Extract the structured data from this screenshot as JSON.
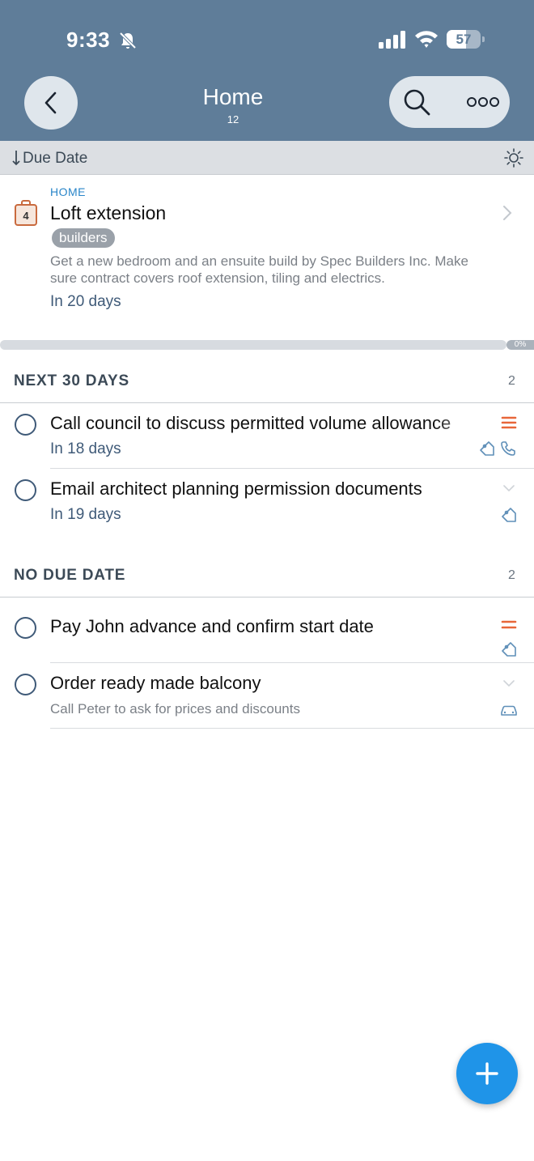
{
  "status_bar": {
    "time": "9:33",
    "battery": "57",
    "battery_level": 0.57
  },
  "header": {
    "title": "Home",
    "count": "12"
  },
  "sort": {
    "label": "Due Date"
  },
  "project": {
    "breadcrumb": "HOME",
    "title": "Loft extension",
    "tag": "builders",
    "notes": "Get a new bedroom and an ensuite build by Spec Builders Inc. Make sure contract covers roof extension, tiling and electrics.",
    "due": "In 20 days",
    "badge_number": "4",
    "progress_label": "0%",
    "progress_value": 0
  },
  "sections": [
    {
      "title": "NEXT 30 DAYS",
      "count": "2",
      "tasks": [
        {
          "title": "Call council to discuss permitted volume allowance",
          "due": "In 18 days",
          "priority": "high",
          "icons": [
            "tag-icon",
            "phone-icon"
          ]
        },
        {
          "title": "Email architect planning permission documents",
          "due": "In 19 days",
          "priority": "none",
          "icons": [
            "tag-icon"
          ]
        }
      ]
    },
    {
      "title": "NO DUE DATE",
      "count": "2",
      "tasks": [
        {
          "title": "Pay John advance and confirm start date",
          "priority": "medium",
          "icons": [
            "tag-icon"
          ]
        },
        {
          "title": "Order ready made balcony",
          "note": "Call Peter to ask for prices and discounts",
          "priority": "none",
          "icons": [
            "car-icon"
          ]
        }
      ]
    }
  ],
  "colors": {
    "header_bg": "#5f7d99",
    "accent_blue": "#2a86c9",
    "priority_orange": "#e8673a",
    "fab_blue": "#1f94e8"
  }
}
